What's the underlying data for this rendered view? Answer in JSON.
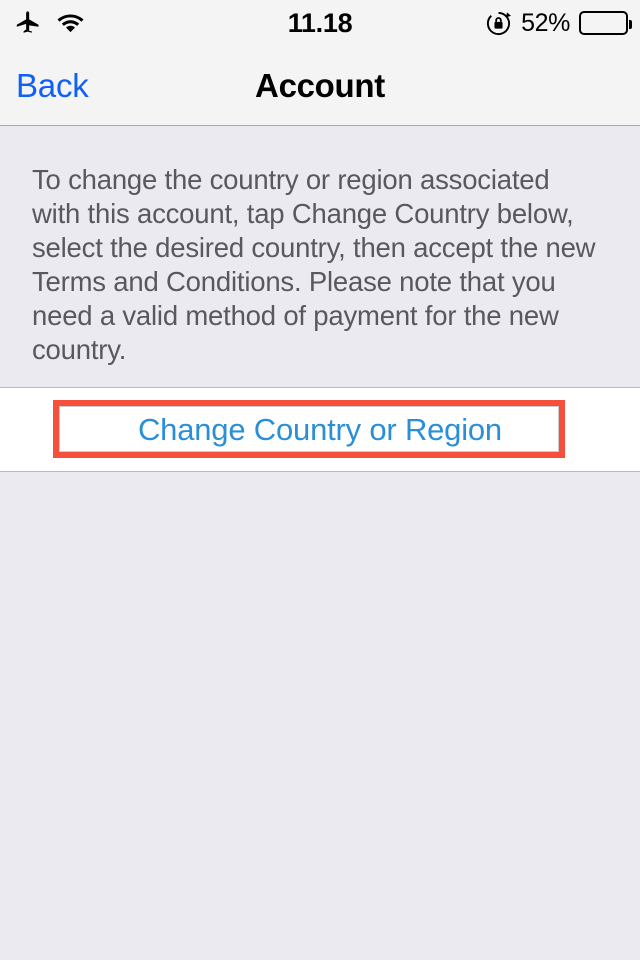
{
  "status_bar": {
    "airplane_icon": "airplane-mode-icon",
    "wifi_icon": "wifi-icon",
    "time": "11.18",
    "rotation_lock_icon": "rotation-lock-icon",
    "battery_percent_label": "52%",
    "battery_level": 52,
    "battery_icon": "battery-icon"
  },
  "nav_bar": {
    "back_label": "Back",
    "title": "Account"
  },
  "main": {
    "description": "To change the country or region associated with this account, tap Change Country below, select the desired country, then accept the new Terms and Conditions. Please note that you need a valid method of payment for the new country.",
    "action_button_label": "Change Country or Region"
  },
  "annotation": {
    "highlight_target": "Change Country or Region",
    "highlight_color": "#f4503c"
  },
  "colors": {
    "back_link_blue": "#0f61f5",
    "action_blue": "#2b8fd8",
    "body_text_gray": "#58585e",
    "bar_background": "#f4f4f4",
    "page_background": "#eaeaf0",
    "row_background": "#ffffff",
    "separator": "#b9b9be",
    "highlight_red": "#f4503c"
  }
}
